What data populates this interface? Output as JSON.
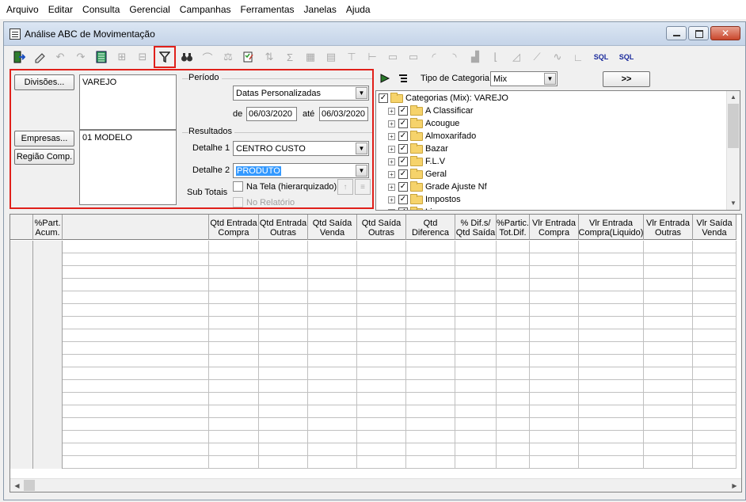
{
  "menu": [
    "Arquivo",
    "Editar",
    "Consulta",
    "Gerencial",
    "Campanhas",
    "Ferramentas",
    "Janelas",
    "Ajuda"
  ],
  "window": {
    "title": "Análise ABC de Movimentação"
  },
  "toolbar": {
    "sql1": "SQL",
    "sql2": "SQL"
  },
  "filters": {
    "divisoes_button": "Divisões...",
    "divisoes_value": "VAREJO",
    "empresas_button": "Empresas...",
    "regiao_button": "Região Comp.",
    "empresas_value": "01 MODELO",
    "periodo_label": "Período",
    "periodo_combo": "Datas Personalizadas",
    "de_label": "de",
    "date_from": "06/03/2020",
    "ate_label": "até",
    "date_to": "06/03/2020",
    "resultados_label": "Resultados",
    "detalhe1_label": "Detalhe 1",
    "detalhe1_value": "CENTRO CUSTO",
    "detalhe2_label": "Detalhe 2",
    "detalhe2_value": "PRODUTO",
    "subtotais_label": "Sub Totais",
    "na_tela_label": "Na Tela (hierarquizado)",
    "no_relatorio_label": "No Relatório"
  },
  "categories": {
    "tipo_label": "Tipo de Categoria",
    "tipo_value": "Mix",
    "go_button": ">>",
    "root": "Categorias (Mix): VAREJO",
    "items": [
      "A Classificar",
      "Acougue",
      "Almoxarifado",
      "Bazar",
      "F.L.V",
      "Geral",
      "Grade Ajuste Nf",
      "Impostos",
      "Limpeza"
    ]
  },
  "grid": {
    "columns": [
      {
        "line1": "",
        "line2": ""
      },
      {
        "line1": "%Part.",
        "line2": "Acum."
      },
      {
        "line1": "",
        "line2": ""
      },
      {
        "line1": "Qtd Entrada",
        "line2": "Compra"
      },
      {
        "line1": "Qtd Entrada",
        "line2": "Outras"
      },
      {
        "line1": "Qtd Saída",
        "line2": "Venda"
      },
      {
        "line1": "Qtd Saída",
        "line2": "Outras"
      },
      {
        "line1": "Qtd",
        "line2": "Diferenca"
      },
      {
        "line1": "% Dif.s/",
        "line2": "Qtd Saída"
      },
      {
        "line1": "%Partic.",
        "line2": "Tot.Dif."
      },
      {
        "line1": "Vlr Entrada",
        "line2": "Compra"
      },
      {
        "line1": "Vlr Entrada",
        "line2": "Compra(Liquido)"
      },
      {
        "line1": "Vlr Entrada",
        "line2": "Outras"
      },
      {
        "line1": "Vlr Saída",
        "line2": "Venda"
      }
    ]
  }
}
